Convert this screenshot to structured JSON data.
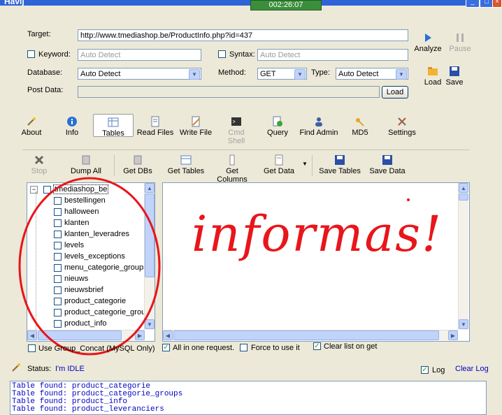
{
  "window": {
    "title": "Havij",
    "timer": "002:26:07"
  },
  "form": {
    "target_label": "Target:",
    "target_value": "http://www.tmediashop.be/ProductInfo.php?id=437",
    "keyword_label": "Keyword:",
    "keyword_placeholder": "Auto Detect",
    "syntax_label": "Syntax:",
    "syntax_placeholder": "Auto Detect",
    "database_label": "Database:",
    "database_value": "Auto Detect",
    "method_label": "Method:",
    "method_value": "GET",
    "type_label": "Type:",
    "type_value": "Auto Detect",
    "postdata_label": "Post Data:",
    "load_button": "Load"
  },
  "side_buttons": {
    "analyze": "Analyze",
    "pause": "Pause",
    "load": "Load",
    "save": "Save"
  },
  "main_tabs": [
    "About",
    "Info",
    "Tables",
    "Read Files",
    "Write File",
    "Cmd Shell",
    "Query",
    "Find Admin",
    "MD5",
    "Settings"
  ],
  "sub_toolbar": [
    "Stop",
    "Dump All",
    "Get DBs",
    "Get Tables",
    "Get Columns",
    "Get Data",
    "Save Tables",
    "Save Data"
  ],
  "tree": {
    "root": "tmediashop_be",
    "tables": [
      "bestellingen",
      "halloween",
      "klanten",
      "klanten_leveradres",
      "levels",
      "levels_exceptions",
      "menu_categorie_groups",
      "nieuws",
      "nieuwsbrief",
      "product_categorie",
      "product_categorie_grou",
      "product_info"
    ]
  },
  "annotation": {
    "text": "informas!",
    "color": "#E8161B"
  },
  "options": {
    "group_concat": "Use Group_Concat (MySQL Only)",
    "all_in_one": "All in one request.",
    "force": "Force to use it",
    "clear_list": "Clear list on get",
    "all_in_one_checked": true,
    "clear_list_checked": true
  },
  "status": {
    "label": "Status:",
    "value": "I'm IDLE",
    "log_label": "Log",
    "log_checked": true,
    "clear_log": "Clear Log"
  },
  "log": [
    "Table found: product_categorie",
    "Table found: product_categorie_groups",
    "Table found: product_info",
    "Table found: product_leveranciers"
  ]
}
